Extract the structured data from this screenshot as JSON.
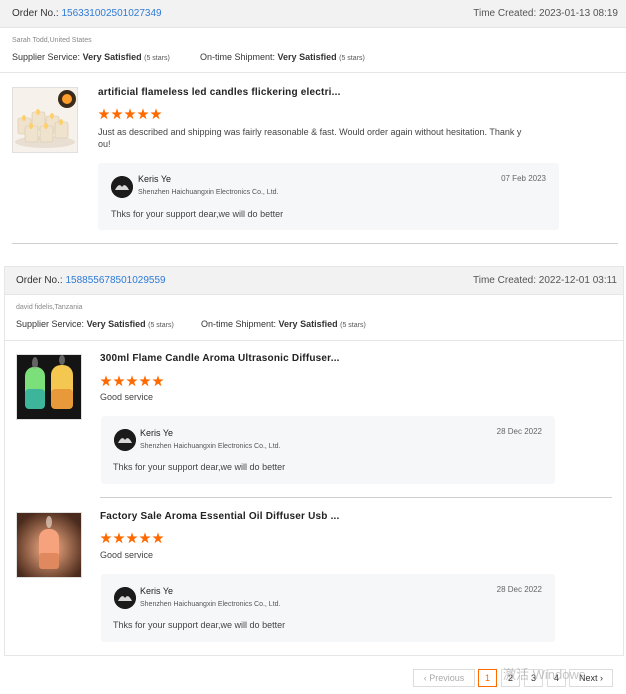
{
  "labels": {
    "order_no": "Order No.:",
    "time_created": "Time Created:",
    "supplier_service": "Supplier Service:",
    "ontime_shipment": "On-time Shipment:"
  },
  "orders": [
    {
      "order_no": "156331002501027349",
      "time_created": "2023-01-13 08:19",
      "buyer": "Sarah Todd,United States",
      "supplier_rating": "Very Satisfied",
      "supplier_stars": "(5 stars)",
      "shipment_rating": "Very Satisfied",
      "shipment_stars": "(5 stars)",
      "items": [
        {
          "title": "artificial flameless led candles flickering electri...",
          "rating": 5,
          "comment_line1": "Just as described and shipping was fairly reasonable & fast. Would order again without hesitation. Thank y",
          "comment_line2": "ou!",
          "reply": {
            "name": "Keris Ye",
            "company": "Shenzhen Haichuangxin Electronics Co., Ltd.",
            "date": "07 Feb 2023",
            "text": "Thks for your support dear,we will do better"
          }
        }
      ]
    },
    {
      "order_no": "158855678501029559",
      "time_created": "2022-12-01 03:11",
      "buyer": "david fidelis,Tanzania",
      "supplier_rating": "Very Satisfied",
      "supplier_stars": "(5 stars)",
      "shipment_rating": "Very Satisfied",
      "shipment_stars": "(5 stars)",
      "items": [
        {
          "title": "300ml Flame Candle Aroma Ultrasonic Diffuser...",
          "rating": 5,
          "comment": "Good service",
          "reply": {
            "name": "Keris Ye",
            "company": "Shenzhen Haichuangxin Electronics Co., Ltd.",
            "date": "28 Dec 2022",
            "text": "Thks for your support dear,we will do better"
          }
        },
        {
          "title": "Factory Sale Aroma Essential Oil Diffuser Usb ...",
          "rating": 5,
          "comment": "Good service",
          "reply": {
            "name": "Keris Ye",
            "company": "Shenzhen Haichuangxin Electronics Co., Ltd.",
            "date": "28 Dec 2022",
            "text": "Thks for your support dear,we will do better"
          }
        }
      ]
    }
  ],
  "pagination": {
    "previous": "Previous",
    "pages": [
      "1",
      "2",
      "3",
      "4"
    ],
    "current": "1",
    "next": "Next"
  },
  "watermark": "激活 Windows",
  "colors": {
    "accent": "#ff6a00",
    "link": "#2e7bd6",
    "header_bg": "#f2f2f2",
    "reply_bg": "#f6f7f9"
  },
  "icons": [
    "star-icon",
    "chevron-left-icon",
    "chevron-right-icon",
    "avatar-logo-icon"
  ]
}
